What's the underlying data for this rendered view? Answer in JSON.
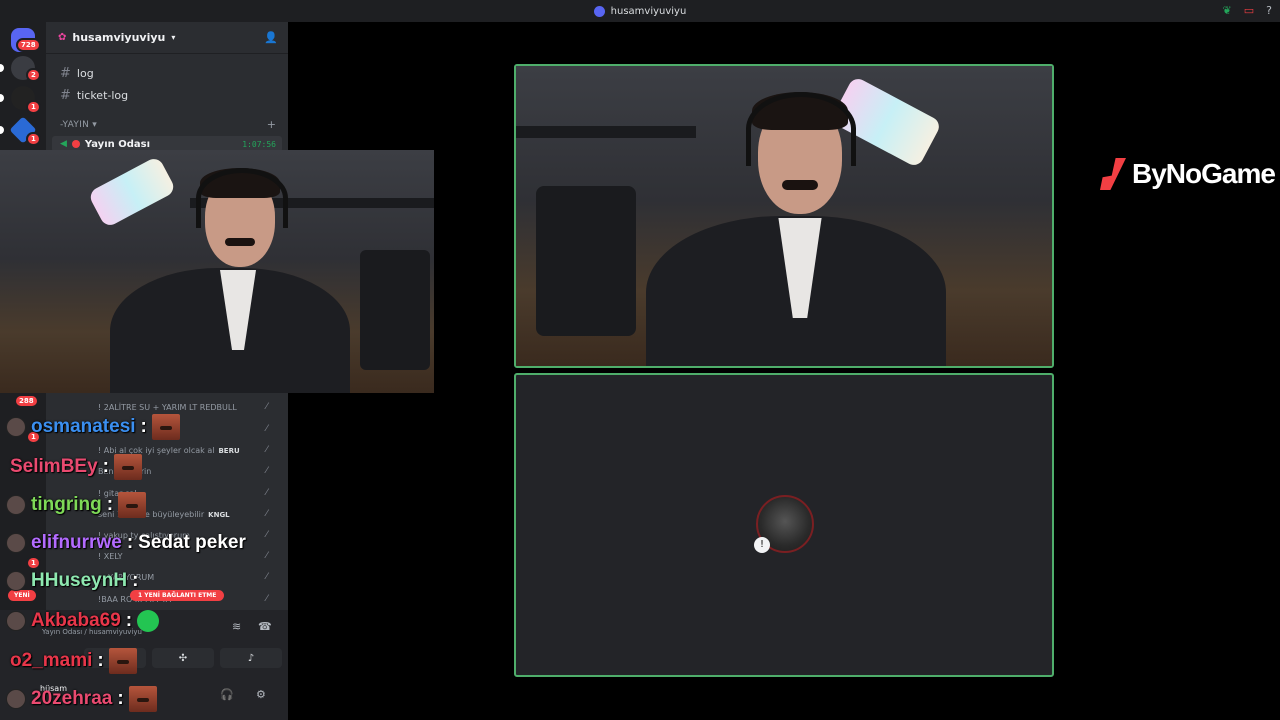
{
  "titlebar": {
    "title": "husamviyuviyu"
  },
  "rail": {
    "dm_badge": "728",
    "items": [
      {
        "badge": "2"
      },
      {
        "badge": "1"
      },
      {
        "badge": "1"
      }
    ],
    "lower_badges": [
      "288",
      "1",
      "1"
    ]
  },
  "server": {
    "name": "husamviyuviyu"
  },
  "channels": {
    "text": [
      "log",
      "ticket-log"
    ],
    "category": "-YAYIN",
    "voice_channel": {
      "name": "Yayın Odası",
      "time": "1:07:56"
    }
  },
  "member_lines": [
    {
      "text": "! 2ALİTRE SU + YARIM LT REDBULL",
      "tag": ""
    },
    {
      "text": "! Abi al çok iyi şeyler olcak al",
      "tag": "BERU"
    },
    {
      "text": "Bana ... verin",
      "tag": ""
    },
    {
      "text": "! gitar çal",
      "tag": ""
    },
    {
      "text": "seni 10 ... de büyüleyebilir",
      "tag": "KNGL"
    },
    {
      "text": "! yakup ty çalıştıyorum",
      "tag": ""
    },
    {
      "text": "! XELY",
      "tag": ""
    },
    {
      "text": "... YAPIYORUM",
      "tag": ""
    },
    {
      "text": "!BAA RO ... ΜΜ YA",
      "tag": ""
    }
  ],
  "chat": [
    {
      "user": "osmanatesi",
      "color": "#3b8ff0",
      "msg": "",
      "emote": true
    },
    {
      "user": "SelimBEy",
      "color": "#ea4a70",
      "msg": "",
      "emote": true
    },
    {
      "user": "tingring",
      "color": "#7ed957",
      "msg": "",
      "emote": true
    },
    {
      "user": "elifnurrwe",
      "color": "#b36bff",
      "msg": "Sedat peker",
      "emote": false
    },
    {
      "user": "HHuseynH",
      "color": "#8ee8b0",
      "msg": "",
      "emote": false
    },
    {
      "user": "Akbaba69",
      "color": "#e8364a",
      "msg": "",
      "emote": false
    },
    {
      "user": "o2_mami",
      "color": "#e8364a",
      "msg": "",
      "emote": true
    },
    {
      "user": "20zehraa",
      "color": "#ea4a70",
      "msg": "",
      "emote": true
    }
  ],
  "chat_separator": ":",
  "voice_panel": {
    "new_label": "YENİ",
    "new_stream_label": "1 YENİ BAĞLANTI ETME",
    "status": "Yayın Odası / husamviyuviyu",
    "user": "hüsam"
  },
  "brand": {
    "name": "ByNoGame"
  },
  "colors": {
    "speaking_border": "#4fae6b",
    "accent_red": "#f23f43"
  }
}
